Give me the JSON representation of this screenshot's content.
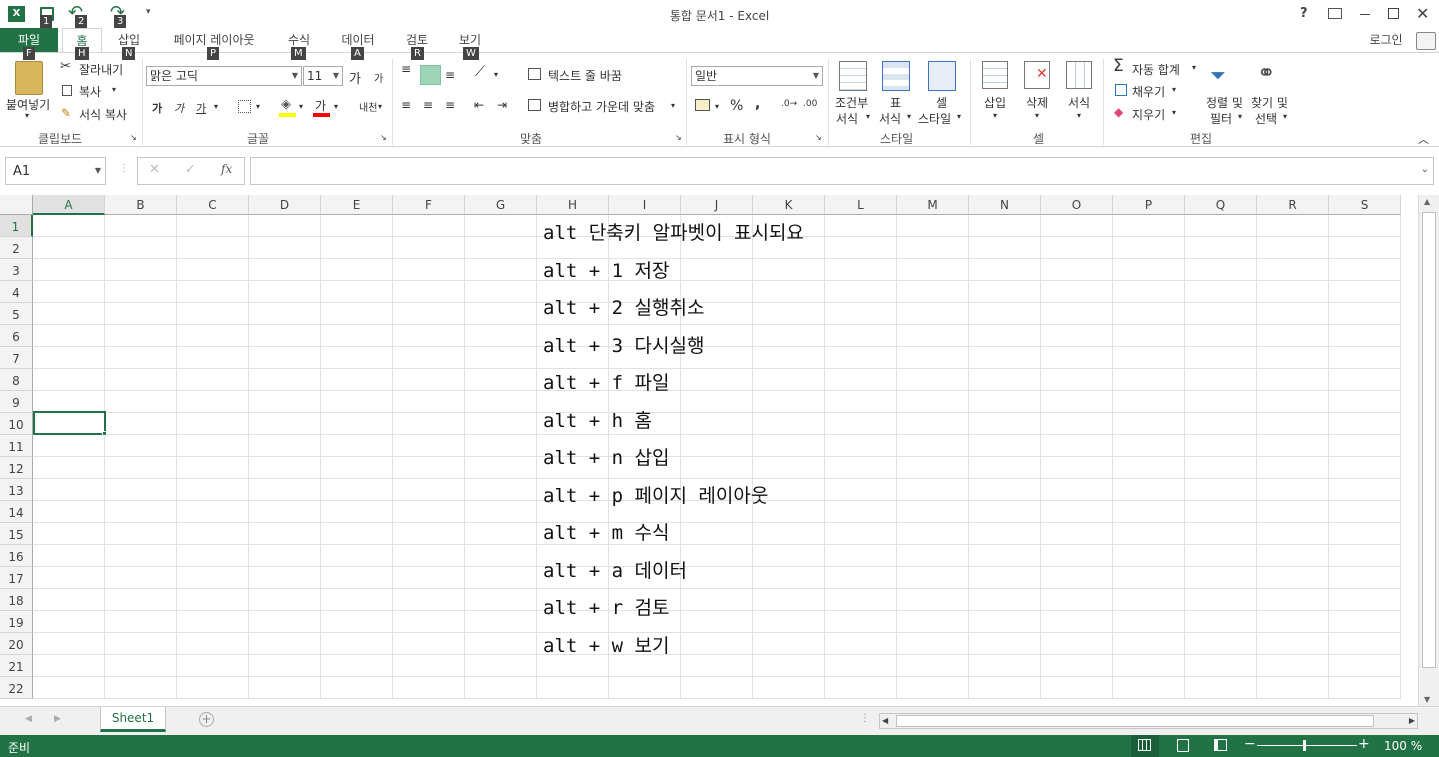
{
  "window": {
    "title": "통합 문서1 - Excel",
    "help": "?",
    "signin": "로그인"
  },
  "qat_keytips": [
    "1",
    "2",
    "3"
  ],
  "tabs": [
    {
      "label": "파일",
      "keytip": "F"
    },
    {
      "label": "홈",
      "keytip": "H"
    },
    {
      "label": "삽입",
      "keytip": "N"
    },
    {
      "label": "페이지 레이아웃",
      "keytip": "P"
    },
    {
      "label": "수식",
      "keytip": "M"
    },
    {
      "label": "데이터",
      "keytip": "A"
    },
    {
      "label": "검토",
      "keytip": "R"
    },
    {
      "label": "보기",
      "keytip": "W"
    }
  ],
  "ribbon": {
    "clipboard": {
      "paste": "붙여넣기",
      "cut": "잘라내기",
      "copy": "복사",
      "format_painter": "서식 복사",
      "label": "클립보드"
    },
    "font": {
      "name": "맑은 고딕",
      "size": "11",
      "bold": "가",
      "italic": "가",
      "underline": "가",
      "grow": "가",
      "shrink": "가",
      "color_letter": "가",
      "phonetic": "내천",
      "label": "글꼴"
    },
    "alignment": {
      "wrap": "텍스트 줄 바꿈",
      "merge": "병합하고 가운데 맞춤",
      "label": "맞춤"
    },
    "number": {
      "format": "일반",
      "percent": "%",
      "comma": ",",
      "label": "표시 형식"
    },
    "styles": {
      "conditional": [
        "조건부",
        "서식"
      ],
      "table": [
        "표",
        "서식"
      ],
      "cell": [
        "셀",
        "스타일"
      ],
      "label": "스타일"
    },
    "cells": {
      "insert": "삽입",
      "delete": "삭제",
      "format": "서식",
      "label": "셀"
    },
    "editing": {
      "autosum": "자동 합계",
      "fill": "채우기",
      "clear": "지우기",
      "sort": [
        "정렬 및",
        "필터"
      ],
      "find": [
        "찾기 및",
        "선택"
      ],
      "label": "편집"
    }
  },
  "formula_bar": {
    "name_box": "A1",
    "fx": "fx",
    "formula": ""
  },
  "columns": [
    "A",
    "B",
    "C",
    "D",
    "E",
    "F",
    "G",
    "H",
    "I",
    "J",
    "K",
    "L",
    "M",
    "N",
    "O",
    "P",
    "Q",
    "R",
    "S"
  ],
  "rows": [
    "1",
    "2",
    "3",
    "4",
    "5",
    "6",
    "7",
    "8",
    "9",
    "10",
    "11",
    "12",
    "13",
    "14",
    "15",
    "16",
    "17",
    "18",
    "19",
    "20",
    "21",
    "22"
  ],
  "cells": [
    {
      "row": 1,
      "text": "alt 단축키 알파벳이 표시되요"
    },
    {
      "row": 3,
      "text": "alt + 1 저장"
    },
    {
      "row": 5,
      "text": "alt + 2 실행취소"
    },
    {
      "row": 7,
      "text": "alt + 3 다시실행"
    },
    {
      "row": 9,
      "text": "alt + f 파일"
    },
    {
      "row": 11,
      "text": "alt + h 홈"
    },
    {
      "row": 13,
      "text": "alt + n 삽입"
    },
    {
      "row": 15,
      "text": "alt + p 페이지 레이아웃"
    },
    {
      "row": 17,
      "text": "alt + m 수식"
    },
    {
      "row": 19,
      "text": "alt + a 데이터"
    },
    {
      "row": 21,
      "text": "alt + r 검토"
    },
    {
      "row": 23,
      "text": "alt + w 보기"
    }
  ],
  "sheet_tab": "Sheet1",
  "status": {
    "ready": "준비",
    "zoom": "100 %"
  },
  "colors": {
    "excel_green": "#217346",
    "header_bg": "#f3f3f3",
    "gridline": "#e1e1e1"
  }
}
